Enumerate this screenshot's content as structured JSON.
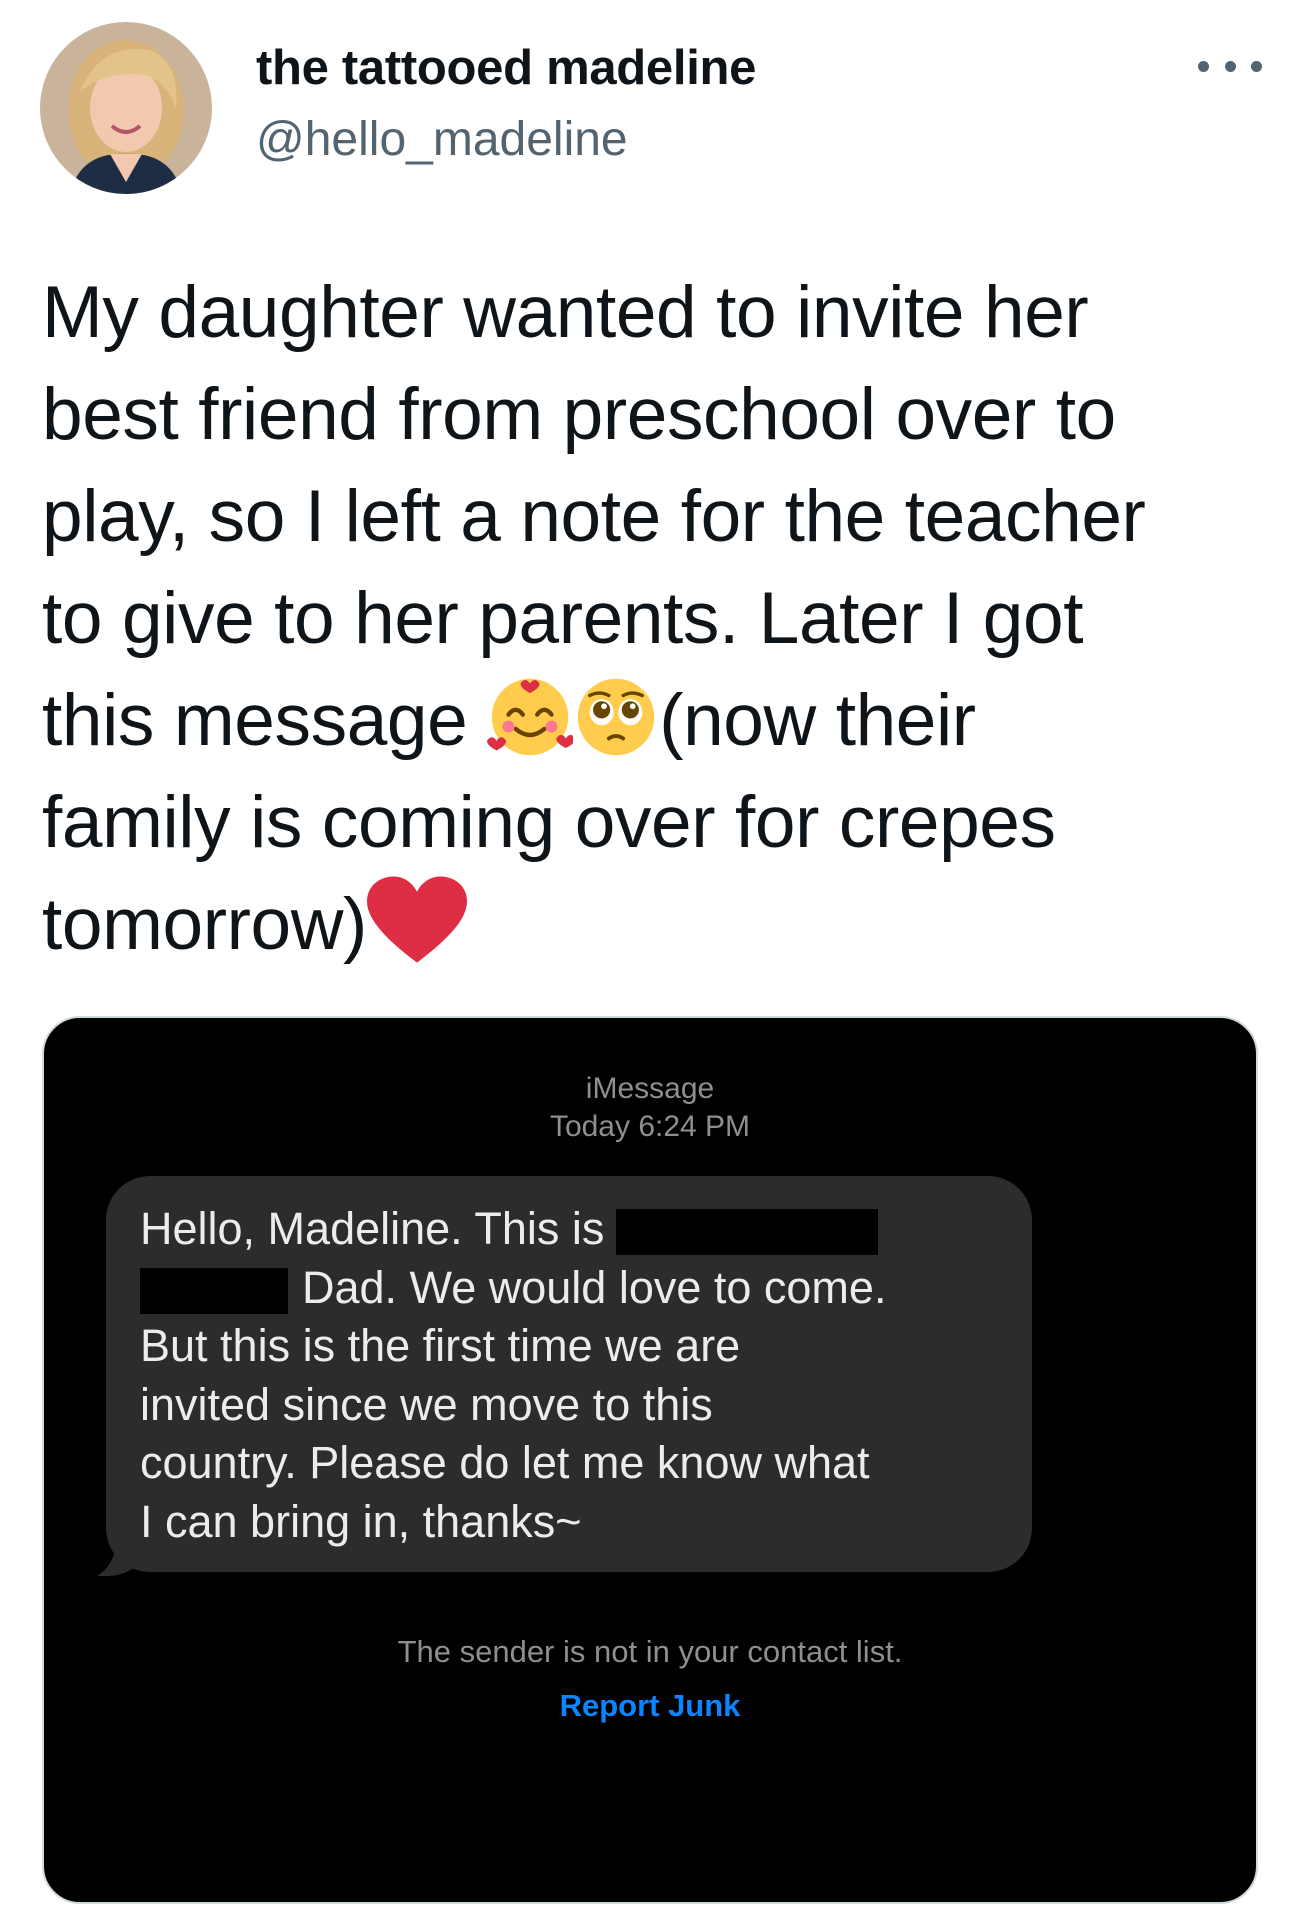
{
  "author": {
    "display_name": "the tattooed madeline",
    "handle": "@hello_madeline"
  },
  "more_menu": {
    "icon": "more-horizontal-icon"
  },
  "tweet": {
    "lines": [
      "My daughter wanted to invite her",
      "best friend from preschool over to",
      "play, so I left a note for the teacher",
      "to give to her parents. Later I got",
      "this message",
      "(now their",
      "family is coming over for crepes",
      "tomorrow)"
    ],
    "emojis": [
      "smiling-face-with-hearts-icon",
      "pleading-face-icon",
      "red-heart-icon"
    ]
  },
  "message": {
    "service": "iMessage",
    "timestamp": "Today 6:24 PM",
    "lines": [
      "Hello, Madeline. This is",
      "Dad. We would love to come.",
      "But this is the first time we are",
      "invited since we move to this",
      "country. Please do let me know what",
      "I can bring in, thanks~"
    ],
    "notice": "The sender is not in your contact list.",
    "report_link": "Report Junk"
  },
  "colors": {
    "text_primary": "#0f1419",
    "text_secondary": "#536471",
    "media_bg": "#000000",
    "bubble_bg": "#2c2c2e",
    "link_blue": "#0a84ff",
    "heart_red": "#dd2e44"
  }
}
